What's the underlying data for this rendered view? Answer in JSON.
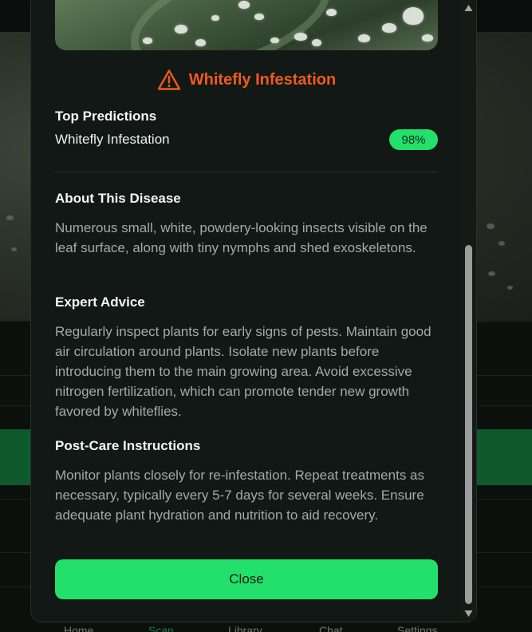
{
  "background": {
    "nav_items": [
      "Home",
      "Scan",
      "Library",
      "Chat",
      "Settings"
    ],
    "nav_active_index": 1
  },
  "modal": {
    "title": "Whitefly Infestation",
    "title_color": "#f05a1c",
    "title_icon": "warning-triangle-icon",
    "top_predictions": {
      "heading": "Top Predictions",
      "items": [
        {
          "label": "Whitefly Infestation",
          "confidence": "98%"
        }
      ]
    },
    "about": {
      "heading": "About This Disease",
      "text": "Numerous small, white, powdery-looking insects visible on the leaf surface, along with tiny nymphs and shed exoskeletons."
    },
    "expert_advice": {
      "heading": "Expert Advice",
      "text": "Regularly inspect plants for early signs of pests. Maintain good air circulation around plants. Isolate new plants before introducing them to the main growing area. Avoid excessive nitrogen fertilization, which can promote tender new growth favored by whiteflies."
    },
    "post_care": {
      "heading": "Post-Care Instructions",
      "text": "Monitor plants closely for re-infestation. Repeat treatments as necessary, typically every 5-7 days for several weeks. Ensure adequate plant hydration and nutrition to aid recovery."
    },
    "close_label": "Close",
    "accent_color": "#22e06b"
  }
}
